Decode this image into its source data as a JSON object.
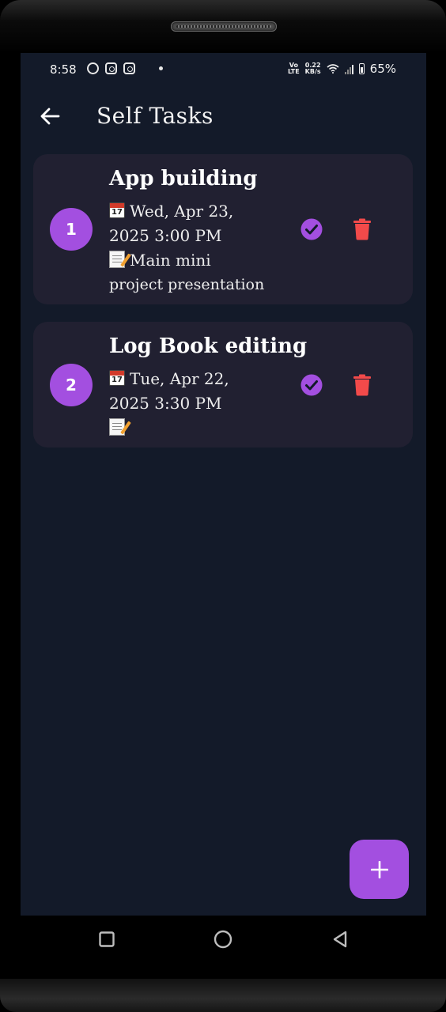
{
  "status_bar": {
    "time": "8:58",
    "net_type_top": "Vo",
    "net_type_bottom": "LTE",
    "speed_top": "0.22",
    "speed_bottom": "KB/s",
    "battery": "65%",
    "notification_icons": [
      "whatsapp-icon",
      "instagram-icon",
      "instagram-icon"
    ]
  },
  "app_bar": {
    "title": "Self Tasks",
    "back_icon": "arrow-left-icon"
  },
  "tasks": [
    {
      "number": "1",
      "title": "App  building",
      "date_line1": "Wed, Apr 23,",
      "date_line2": "2025 3:00 PM",
      "note_line1": "Main mini",
      "note_line2": "project presentation"
    },
    {
      "number": "2",
      "title": "Log Book editing",
      "date_line1": "Tue, Apr 22,",
      "date_line2": "2025 3:30 PM",
      "note_line1": "",
      "note_line2": ""
    }
  ],
  "fab": {
    "icon": "plus-icon"
  },
  "nav_bar": {
    "buttons": [
      "recent-apps-icon",
      "home-icon",
      "back-triangle-icon"
    ]
  },
  "colors": {
    "background": "#131a29",
    "card": "#212031",
    "accent": "#a34fe0",
    "delete": "#f24a4a"
  }
}
